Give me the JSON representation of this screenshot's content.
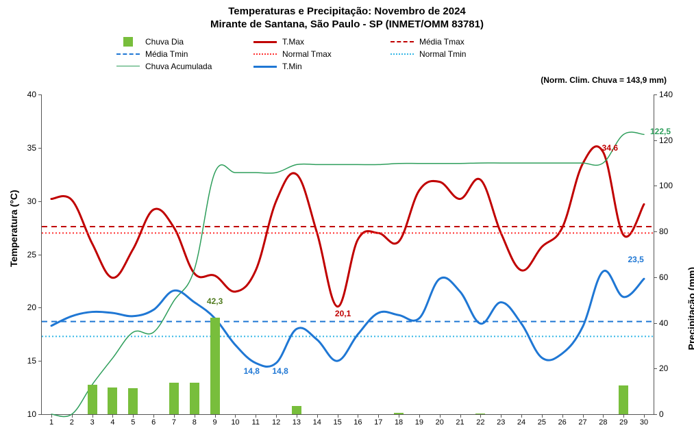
{
  "chart_data": {
    "type": "combo",
    "title": "Temperaturas e Precipitação: Novembro de 2024",
    "subtitle": "Mirante de Santana, São Paulo - SP (INMET/OMM 83781)",
    "note": "(Norm. Clim. Chuva = 143,9 mm)",
    "xlabel": "",
    "ylabel_left": "Temperatura (°C)",
    "ylabel_right": "Precipitação (mm)",
    "ylim_left": [
      10,
      40
    ],
    "ylim_right": [
      0,
      140
    ],
    "yticks_left": [
      10,
      15,
      20,
      25,
      30,
      35,
      40
    ],
    "yticks_right": [
      0,
      20,
      40,
      60,
      80,
      100,
      120,
      140
    ],
    "categories": [
      1,
      2,
      3,
      4,
      5,
      6,
      7,
      8,
      9,
      10,
      11,
      12,
      13,
      14,
      15,
      16,
      17,
      18,
      19,
      20,
      21,
      22,
      23,
      24,
      25,
      26,
      27,
      28,
      29,
      30
    ],
    "series": [
      {
        "name": "Chuva Dia",
        "swatch": "bar-green",
        "axis": "right",
        "type": "bar",
        "values": [
          0,
          0,
          13.0,
          11.6,
          11.3,
          0,
          13.8,
          13.8,
          42.3,
          0,
          0,
          0,
          3.5,
          0,
          0,
          0,
          0,
          0.5,
          0,
          0,
          0,
          0.2,
          0,
          0,
          0,
          0,
          0,
          0,
          12.5,
          0
        ]
      },
      {
        "name": "T.Max",
        "swatch": "line-red",
        "axis": "left",
        "type": "line",
        "color": "#c00000",
        "width": 3,
        "values": [
          30.2,
          30.1,
          26.0,
          22.8,
          25.5,
          29.2,
          27.5,
          23.2,
          23.0,
          21.5,
          23.5,
          30.0,
          32.5,
          27.0,
          20.1,
          26.4,
          27.0,
          26.2,
          31.0,
          31.8,
          30.2,
          32.0,
          27.0,
          23.5,
          25.7,
          27.5,
          33.5,
          34.6,
          26.8,
          29.7
        ]
      },
      {
        "name": "Média Tmax",
        "swatch": "dash-red",
        "axis": "left",
        "type": "hline",
        "color": "#c00000",
        "dash": "8,6",
        "width": 2,
        "value": 27.6
      },
      {
        "name": "Média Tmin",
        "swatch": "dash-blue",
        "axis": "left",
        "type": "hline",
        "color": "#1f77d4",
        "dash": "8,6",
        "width": 2,
        "value": 18.7
      },
      {
        "name": "Normal Tmax",
        "swatch": "dot-red",
        "axis": "left",
        "type": "hline",
        "color": "#ff3030",
        "dash": "2,3",
        "width": 2,
        "value": 27.0
      },
      {
        "name": "Normal Tmin",
        "swatch": "dot-blue",
        "axis": "left",
        "type": "hline",
        "color": "#33b6e6",
        "dash": "2,3",
        "width": 2,
        "value": 17.3
      },
      {
        "name": "Chuva Acumulada",
        "swatch": "line-green",
        "axis": "right",
        "type": "line",
        "color": "#2e9e5b",
        "width": 1.5,
        "values": [
          0,
          0,
          13.0,
          24.6,
          35.9,
          35.9,
          49.7,
          63.5,
          105.8,
          105.8,
          105.8,
          105.8,
          109.3,
          109.3,
          109.3,
          109.3,
          109.3,
          109.8,
          109.8,
          109.8,
          109.8,
          110.0,
          110.0,
          110.0,
          110.0,
          110.0,
          110.0,
          110.0,
          122.5,
          122.5
        ]
      },
      {
        "name": "T.Min",
        "swatch": "line-blue",
        "axis": "left",
        "type": "line",
        "color": "#1f77d4",
        "width": 3,
        "values": [
          18.3,
          19.2,
          19.6,
          19.5,
          19.2,
          19.8,
          21.6,
          20.5,
          19.0,
          16.5,
          14.8,
          14.8,
          18.0,
          17.0,
          15.0,
          17.5,
          19.5,
          19.3,
          19.0,
          22.7,
          21.5,
          18.5,
          20.5,
          18.5,
          15.3,
          15.7,
          18.2,
          23.4,
          21.0,
          22.7
        ]
      }
    ],
    "data_labels": [
      {
        "text": "42,3",
        "color": "#4f7a1e",
        "day": 9,
        "axis": "right",
        "value": 42.3,
        "dy": -24,
        "dx": 0
      },
      {
        "text": "14,8",
        "color": "#1f77d4",
        "day": 11,
        "axis": "left",
        "value": 14.8,
        "dy": 12,
        "dx": -6
      },
      {
        "text": "14,8",
        "color": "#1f77d4",
        "day": 12,
        "axis": "left",
        "value": 14.8,
        "dy": 12,
        "dx": 6
      },
      {
        "text": "20,1",
        "color": "#c00000",
        "day": 15,
        "axis": "left",
        "value": 20.1,
        "dy": 10,
        "dx": 8
      },
      {
        "text": "34,6",
        "color": "#c00000",
        "day": 28,
        "axis": "left",
        "value": 34.6,
        "dy": -6,
        "dx": 10
      },
      {
        "text": "23,5",
        "color": "#1f77d4",
        "day": 29,
        "axis": "left",
        "value": 23.5,
        "dy": -16,
        "dx": 18
      },
      {
        "text": "122,5",
        "color": "#2e9e5b",
        "day": 30,
        "axis": "right",
        "value": 122.5,
        "dy": -4,
        "dx": 24
      }
    ]
  },
  "legend_order": [
    "Chuva Dia",
    "T.Max",
    "Média Tmax",
    "Média Tmin",
    "Normal Tmax",
    "Normal Tmin",
    "Chuva Acumulada",
    "T.Min"
  ]
}
